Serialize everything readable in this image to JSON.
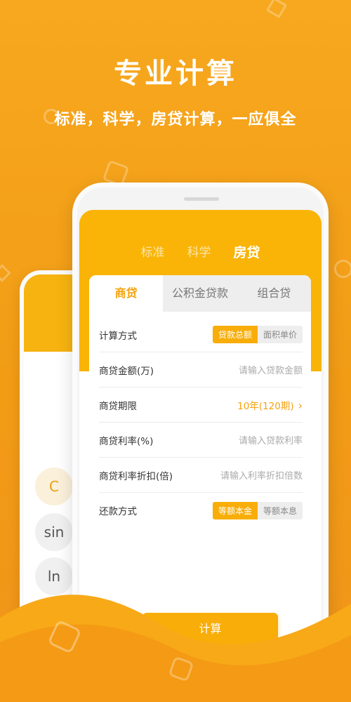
{
  "hero": {
    "title": "专业计算",
    "subtitle": "标准，科学，房贷计算，一应俱全"
  },
  "colors": {
    "background": "#f29c16",
    "accent": "#f8ad08",
    "header": "#f9b407",
    "active_tab_text": "#f5a30f"
  },
  "back_phone": {
    "keys": [
      "C",
      "sin",
      "ln"
    ]
  },
  "app": {
    "mode_tabs": [
      {
        "label": "标准",
        "active": false
      },
      {
        "label": "科学",
        "active": false
      },
      {
        "label": "房贷",
        "active": true
      }
    ],
    "loan_tabs": [
      {
        "label": "商贷",
        "active": true
      },
      {
        "label": "公积金贷款",
        "active": false
      },
      {
        "label": "组合贷",
        "active": false
      }
    ],
    "rows": {
      "calc_method": {
        "label": "计算方式",
        "options": [
          "贷款总额",
          "面积单价"
        ],
        "selected": "贷款总额"
      },
      "amount": {
        "label": "商贷金额(万)",
        "placeholder": "请输入贷款金额"
      },
      "term": {
        "label": "商贷期限",
        "value": "10年(120期)"
      },
      "rate": {
        "label": "商贷利率(%)",
        "placeholder": "请输入贷款利率"
      },
      "discount": {
        "label": "商贷利率折扣(倍)",
        "placeholder": "请输入利率折扣倍数"
      },
      "repayment": {
        "label": "还款方式",
        "options": [
          "等额本金",
          "等额本息"
        ],
        "selected": "等额本金"
      }
    },
    "calculate_label": "计算"
  },
  "icons": [
    "chevron-right-icon",
    "history-icon",
    "settings-icon"
  ]
}
